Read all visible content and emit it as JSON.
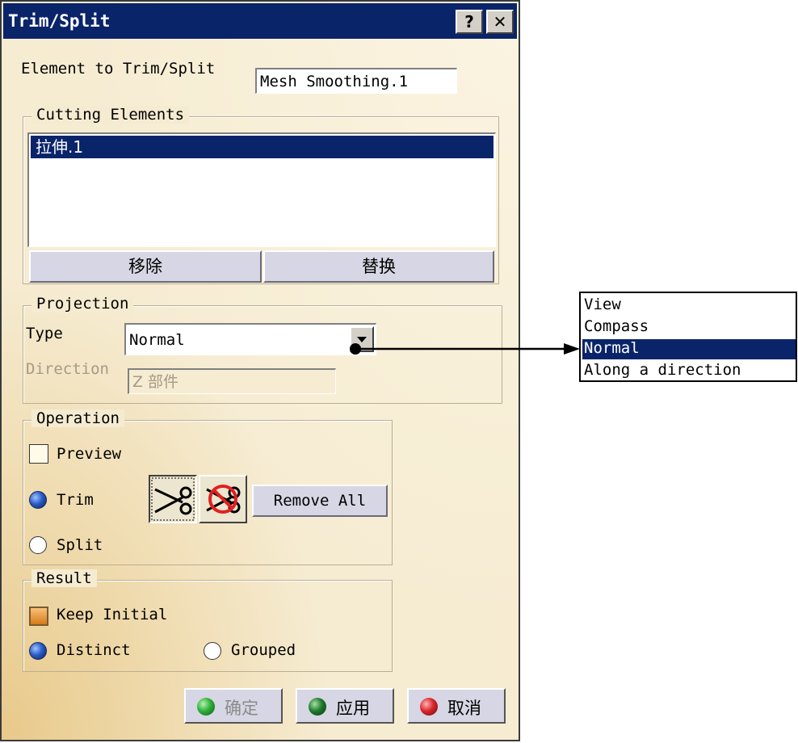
{
  "dialog": {
    "title": "Trim/Split",
    "help_label": "?",
    "close_label": "✕",
    "element_label": "Element to Trim/Split",
    "element_value": "Mesh Smoothing.1",
    "cutting": {
      "legend": "Cutting Elements",
      "items": [
        "拉伸.1"
      ],
      "remove_label": "移除",
      "replace_label": "替换"
    },
    "projection": {
      "legend": "Projection",
      "type_label": "Type",
      "type_value": "Normal",
      "direction_label": "Direction",
      "direction_value": "Z 部件"
    },
    "operation": {
      "legend": "Operation",
      "preview_label": "Preview",
      "preview_checked": false,
      "trim_label": "Trim",
      "split_label": "Split",
      "selected": "Trim",
      "remove_all_label": "Remove All"
    },
    "result": {
      "legend": "Result",
      "keep_initial_label": "Keep Initial",
      "keep_initial_checked": true,
      "distinct_label": "Distinct",
      "grouped_label": "Grouped",
      "selected": "Distinct"
    },
    "buttons": {
      "ok_label": "确定",
      "apply_label": "应用",
      "cancel_label": "取消"
    }
  },
  "dropdown_callout": {
    "options": [
      "View",
      "Compass",
      "Normal",
      "Along a direction"
    ],
    "selected": "Normal"
  },
  "colors": {
    "titlebar": "#0a246a",
    "dialog_bg": "#f6ecd2",
    "selection": "#0a246a",
    "ok_ball": "#2fae3a",
    "apply_ball": "#1f7a2c",
    "cancel_ball": "#d8252a"
  }
}
